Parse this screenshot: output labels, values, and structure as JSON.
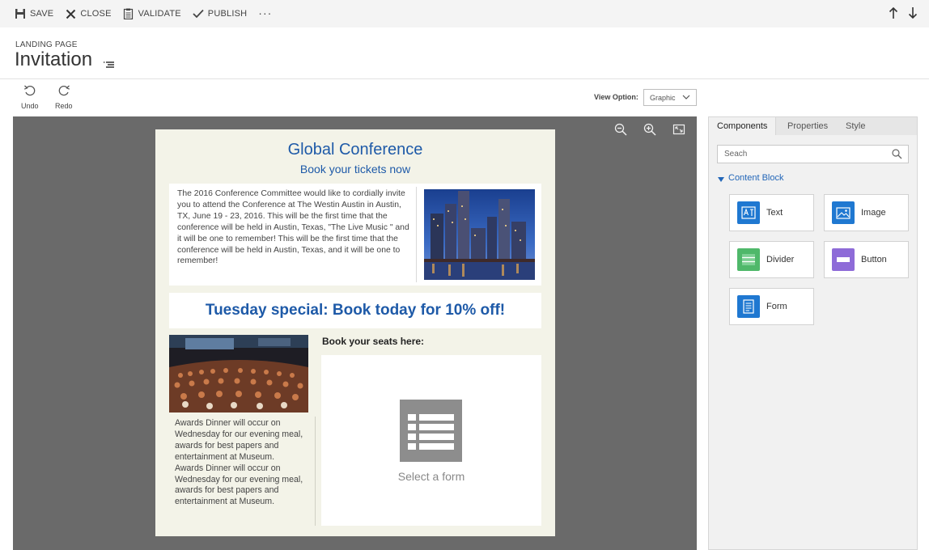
{
  "toolbar": {
    "save": "SAVE",
    "close": "CLOSE",
    "validate": "VALIDATE",
    "publish": "PUBLISH",
    "more": "···"
  },
  "header": {
    "entity_type": "LANDING PAGE",
    "title": "Invitation"
  },
  "history": {
    "undo": "Undo",
    "redo": "Redo"
  },
  "view_option": {
    "label": "View Option:",
    "value": "Graphic"
  },
  "email": {
    "title": "Global Conference",
    "subtitle": "Book your tickets now",
    "intro": "The 2016 Conference Committee would like to cordially invite you to attend the Conference at The Westin Austin in Austin, TX, June 19 - 23, 2016. This will be the first time that the conference will be held in Austin, Texas, \"The Live Music \" and it will be one to remember! This will be the first time that the conference will be held in Austin, Texas, and it will be one to remember!",
    "special": "Tuesday special: Book today for 10% off!",
    "awards": "Awards Dinner will occur on Wednesday for our evening meal, awards for best papers and entertainment at Museum. Awards Dinner will occur on Wednesday for our evening meal, awards for best papers and entertainment at Museum.",
    "book_seats": "Book  your seats here:",
    "form_placeholder": "Select a form"
  },
  "panel": {
    "tabs": [
      "Components",
      "Properties",
      "Style"
    ],
    "active_tab": "Components",
    "search_placeholder": "Seach",
    "section": "Content Block",
    "components": [
      {
        "label": "Text",
        "icon": "text-icon",
        "color": "#1f78d1"
      },
      {
        "label": "Image",
        "icon": "image-icon",
        "color": "#1f78d1"
      },
      {
        "label": "Divider",
        "icon": "divider-icon",
        "color": "#4fb86a"
      },
      {
        "label": "Button",
        "icon": "button-icon",
        "color": "#8e6bd8"
      },
      {
        "label": "Form",
        "icon": "form-icon",
        "color": "#1f78d1"
      }
    ]
  },
  "colors": {
    "accent": "#1e5aa8",
    "canvas": "#6a6a6a",
    "email_bg": "#f3f3e8"
  }
}
